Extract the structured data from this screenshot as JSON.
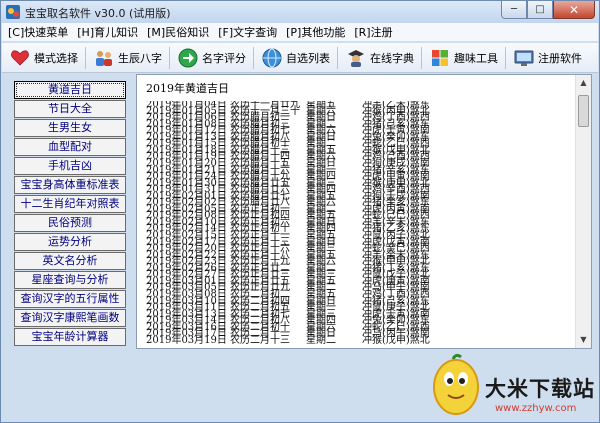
{
  "window": {
    "title": "宝宝取名软件 v30.0 (试用版)",
    "app_icon": "app-icon"
  },
  "window_controls": {
    "minimize": "─",
    "maximize": "□",
    "close": "✕"
  },
  "menu": [
    "[C]快速菜单",
    "[H]育儿知识",
    "[M]民俗知识",
    "[F]文字查询",
    "[P]其他功能",
    "[R]注册"
  ],
  "toolbar": [
    {
      "label": "模式选择",
      "icon": "heart-icon"
    },
    {
      "label": "生辰八字",
      "icon": "people-icon"
    },
    {
      "label": "名字评分",
      "icon": "arrow-icon"
    },
    {
      "label": "自选列表",
      "icon": "globe-icon"
    },
    {
      "label": "在线字典",
      "icon": "scholar-icon"
    },
    {
      "label": "趣味工具",
      "icon": "windows-icon"
    },
    {
      "label": "注册软件",
      "icon": "monitor-icon"
    }
  ],
  "nav": [
    "黄道吉日",
    "节日大全",
    "生男生女",
    "血型配对",
    "手机吉凶",
    "宝宝身高体重标准表",
    "十二生肖纪年对照表",
    "民俗预测",
    "运势分析",
    "英文名分析",
    "星座查询与分析",
    "查询汉字的五行属性",
    "查询汉字康熙笔画数",
    "宝宝年龄计算器"
  ],
  "nav_active": "黄道吉日",
  "list_header": "2019年黄道吉日",
  "rows": [
    [
      "2019年01月04日",
      "农历十一月廿九",
      "星期五",
      "冲羊(乙未)煞东"
    ],
    [
      "2019年01月05日",
      "农历十一月三十",
      "星期六",
      "冲猴(丙申)煞北"
    ],
    [
      "2019年01月06日",
      "农历腊月初一",
      "星期日",
      "冲鸡(丁酉)煞西"
    ],
    [
      "2019年01月08日",
      "农历腊月初三",
      "星期二",
      "冲猪(己亥)煞东"
    ],
    [
      "2019年01月12日",
      "农历腊月初七",
      "星期六",
      "冲虎(壬寅)煞南"
    ],
    [
      "2019年01月13日",
      "农历腊月初八",
      "星期日",
      "冲兔(癸卯)煞东"
    ],
    [
      "2019年01月15日",
      "农历腊月初十",
      "星期二",
      "冲蛇(乙巳)煞西"
    ],
    [
      "2019年01月18日",
      "农历腊月十三",
      "星期五",
      "冲猴(戊申)煞北"
    ],
    [
      "2019年01月19日",
      "农历腊月十四",
      "星期六",
      "冲鸡(己酉)煞西"
    ],
    [
      "2019年01月20日",
      "农历腊月十五",
      "星期日",
      "冲狗(庚戌)煞南"
    ],
    [
      "2019年01月21日",
      "农历腊月十六",
      "星期一",
      "冲猪(辛亥)煞东"
    ],
    [
      "2019年01月24日",
      "农历腊月十九",
      "星期四",
      "冲虎(甲寅)煞南"
    ],
    [
      "2019年01月30日",
      "农历腊月廿五",
      "星期三",
      "冲猴(庚申)煞北"
    ],
    [
      "2019年01月31日",
      "农历腊月廿六",
      "星期四",
      "冲鸡(辛酉)煞西"
    ],
    [
      "2019年02月01日",
      "农历腊月廿七",
      "星期五",
      "冲狗(壬戌)煞南"
    ],
    [
      "2019年02月02日",
      "农历腊月廿八",
      "星期六",
      "冲猪(癸亥)煞东"
    ],
    [
      "2019年02月05日",
      "农历正月初一",
      "星期二",
      "冲虎(丙寅)煞南"
    ],
    [
      "2019年02月08日",
      "农历正月初四",
      "星期五",
      "冲蛇(己巳)煞西"
    ],
    [
      "2019年02月10日",
      "农历正月初六",
      "星期日",
      "冲羊(辛未)煞东"
    ],
    [
      "2019年02月14日",
      "农历正月初十",
      "星期四",
      "冲猪(乙亥)煞东"
    ],
    [
      "2019年02月15日",
      "农历正月十一",
      "星期五",
      "冲鼠(丙子)煞北"
    ],
    [
      "2019年02月17日",
      "农历正月十三",
      "星期日",
      "冲虎(戊寅)煞南"
    ],
    [
      "2019年02月20日",
      "农历正月十六",
      "星期三",
      "冲蛇(辛巳)煞西"
    ],
    [
      "2019年02月22日",
      "农历正月十八",
      "星期五",
      "冲羊(癸未)煞东"
    ],
    [
      "2019年02月23日",
      "农历正月十九",
      "星期六",
      "冲猴(甲申)煞北"
    ],
    [
      "2019年02月26日",
      "农历正月廿二",
      "星期二",
      "冲猪(丁亥)煞东"
    ],
    [
      "2019年02月27日",
      "农历正月廿三",
      "星期三",
      "冲鼠(戊子)煞北"
    ],
    [
      "2019年03月01日",
      "农历正月廿五",
      "星期五",
      "冲虎(庚寅)煞南"
    ],
    [
      "2019年03月05日",
      "农历正月廿九",
      "星期二",
      "冲马(甲午)煞南"
    ],
    [
      "2019年03月08日",
      "农历二月初二",
      "星期五",
      "冲鸡(丁酉)煞西"
    ],
    [
      "2019年03月10日",
      "农历二月初四",
      "星期日",
      "冲猪(己亥)煞东"
    ],
    [
      "2019年03月11日",
      "农历二月初五",
      "星期一",
      "冲鼠(庚子)煞北"
    ],
    [
      "2019年03月13日",
      "农历二月初七",
      "星期三",
      "冲虎(壬寅)煞南"
    ],
    [
      "2019年03月14日",
      "农历二月初八",
      "星期四",
      "冲兔(癸卯)煞东"
    ],
    [
      "2019年03月16日",
      "农历二月初十",
      "星期六",
      "冲蛇(乙巳)煞西"
    ],
    [
      "2019年03月17日",
      "农历二月十一",
      "星期日",
      "冲马(丙午)煞南"
    ],
    [
      "2019年03月19日",
      "农历二月十三",
      "星期二",
      "冲猴(戊申)煞北"
    ]
  ],
  "watermark": {
    "name": "大米下载站",
    "url": "www.zzhyw.com"
  },
  "colors": {
    "window_bg": "#cfdeef",
    "nav_text": "#000080",
    "watermark_url": "#d23a2c"
  }
}
